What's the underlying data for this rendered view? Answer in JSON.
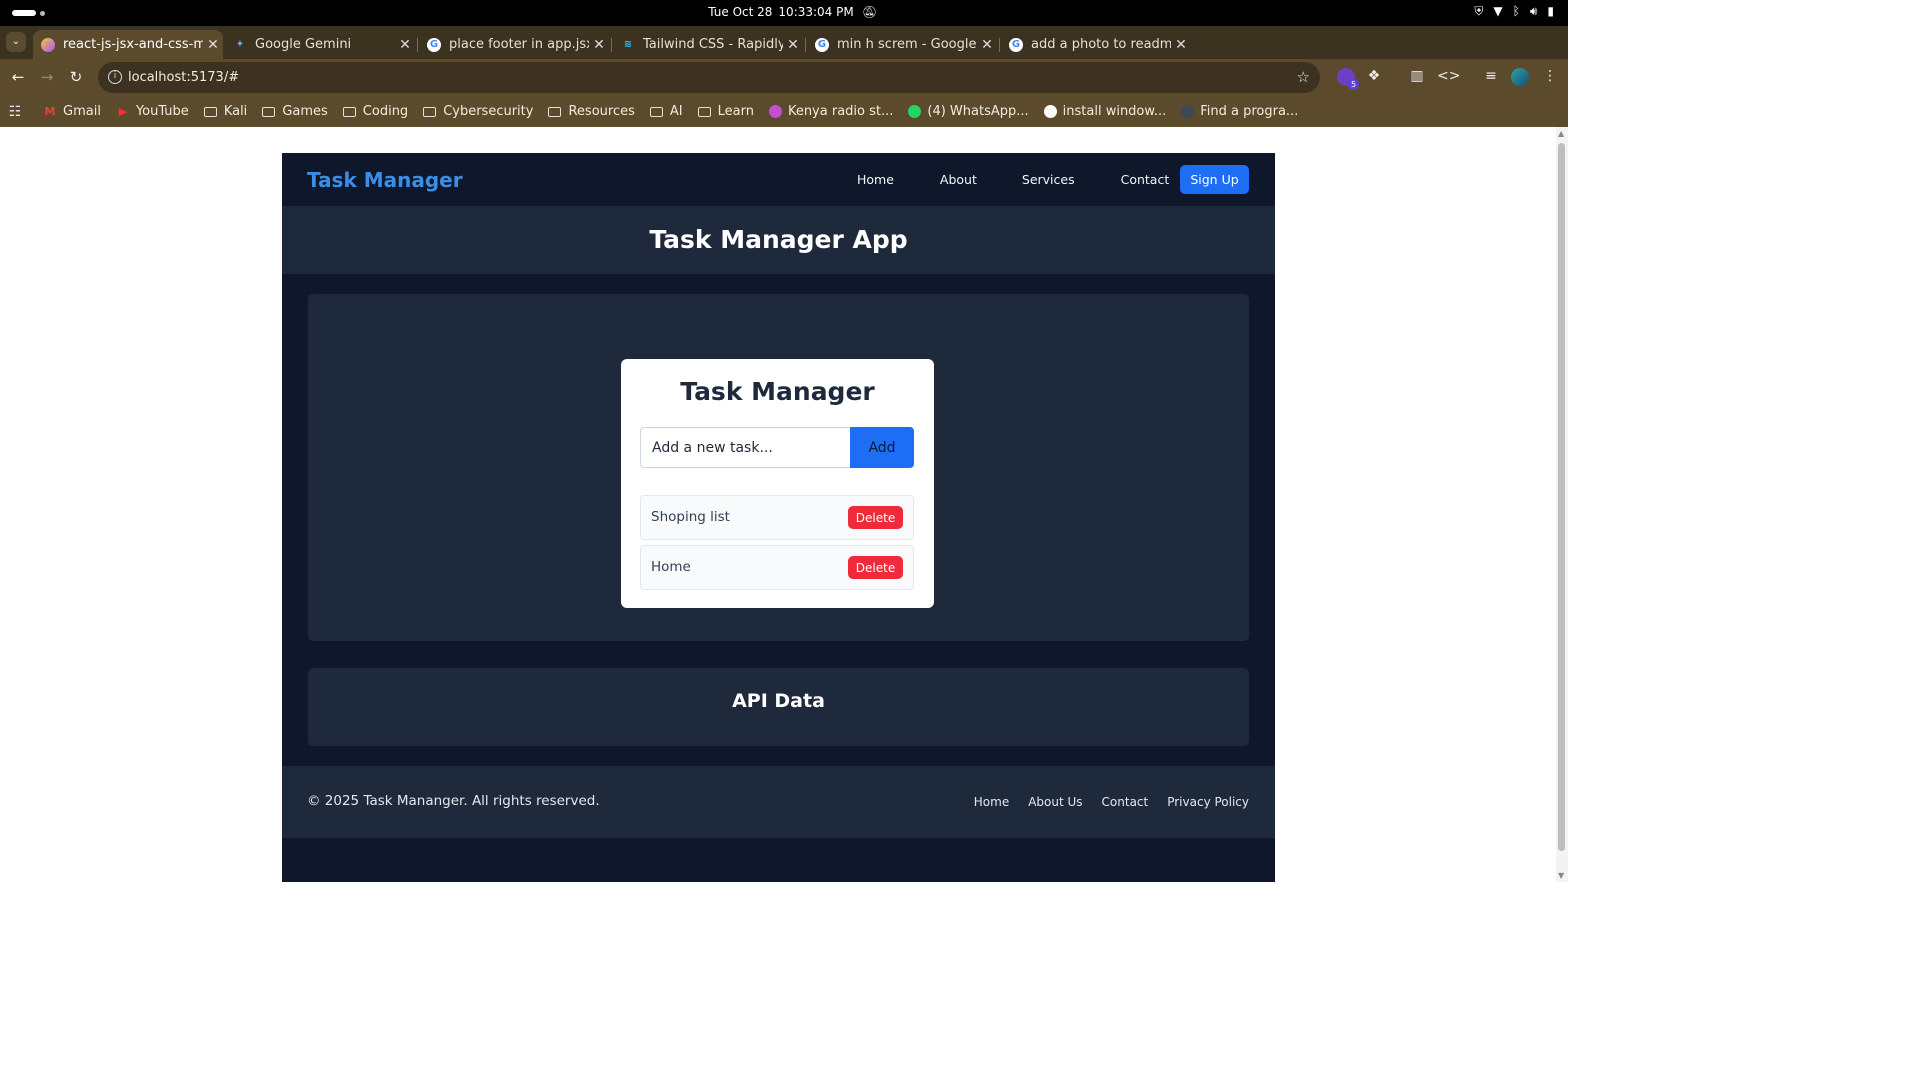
{
  "system": {
    "date": "Tue Oct 28",
    "time": "10:33:04 PM"
  },
  "tabs": [
    {
      "title": "react-js-jsx-and-css-mas",
      "active": true
    },
    {
      "title": "Google Gemini"
    },
    {
      "title": "place footer in app.jsx -"
    },
    {
      "title": "Tailwind CSS - Rapidly b"
    },
    {
      "title": "min h screm - Google S"
    },
    {
      "title": "add a photo to readme"
    }
  ],
  "address_bar": {
    "url": "localhost:5173/#"
  },
  "extensions": {
    "badge_count": "5"
  },
  "bookmarks": [
    {
      "label": "Gmail",
      "icon": "gmail-icon"
    },
    {
      "label": "YouTube",
      "icon": "youtube-icon"
    },
    {
      "label": "Kali",
      "icon": "folder-icon"
    },
    {
      "label": "Games",
      "icon": "folder-icon"
    },
    {
      "label": "Coding",
      "icon": "folder-icon"
    },
    {
      "label": "Cybersecurity",
      "icon": "folder-icon"
    },
    {
      "label": "Resources",
      "icon": "folder-icon"
    },
    {
      "label": "AI",
      "icon": "folder-icon"
    },
    {
      "label": "Learn",
      "icon": "folder-icon"
    },
    {
      "label": "Kenya radio st...",
      "icon": "radio-icon"
    },
    {
      "label": "(4) WhatsApp...",
      "icon": "whatsapp-icon"
    },
    {
      "label": "install window...",
      "icon": "google-icon"
    },
    {
      "label": "Find a progra...",
      "icon": "app-icon"
    }
  ],
  "app": {
    "brand": "Task Manager",
    "nav": [
      "Home",
      "About",
      "Services",
      "Contact"
    ],
    "signup_label": "Sign Up",
    "header_title": "Task Manager App",
    "card_title": "Task Manager",
    "input_placeholder": "Add a new task...",
    "add_label": "Add",
    "tasks": [
      {
        "name": "Shoping list",
        "action": "Delete"
      },
      {
        "name": "Home",
        "action": "Delete"
      }
    ],
    "api_title": "API Data",
    "footer_copy": "© 2025 Task Mananger. All rights reserved.",
    "footer_links": [
      "Home",
      "About Us",
      "Contact",
      "Privacy Policy"
    ]
  },
  "colors": {
    "accent_blue": "#1d6ef5",
    "brand_blue": "#3b8ee8",
    "delete_red": "#ef2b3b",
    "app_bg": "#0f172a",
    "panel_bg": "#1e293b",
    "browser_frame": "#5b4a2c"
  }
}
